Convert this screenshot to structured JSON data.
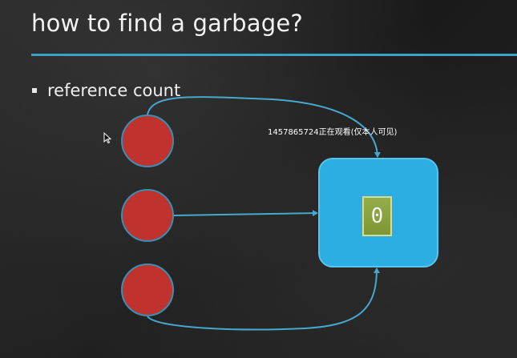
{
  "slide": {
    "title": "how to find a garbage?",
    "bullets": [
      "reference count"
    ],
    "counter_value": "0",
    "watermark": "1457865724正在观看(仅本人可见)",
    "colors": {
      "accent_rule": "#37a3c9",
      "reference": "#c0322d",
      "object": "#2daee3",
      "counter": "#8aa23f"
    }
  },
  "icons": [
    "cursor-arrow-icon"
  ]
}
